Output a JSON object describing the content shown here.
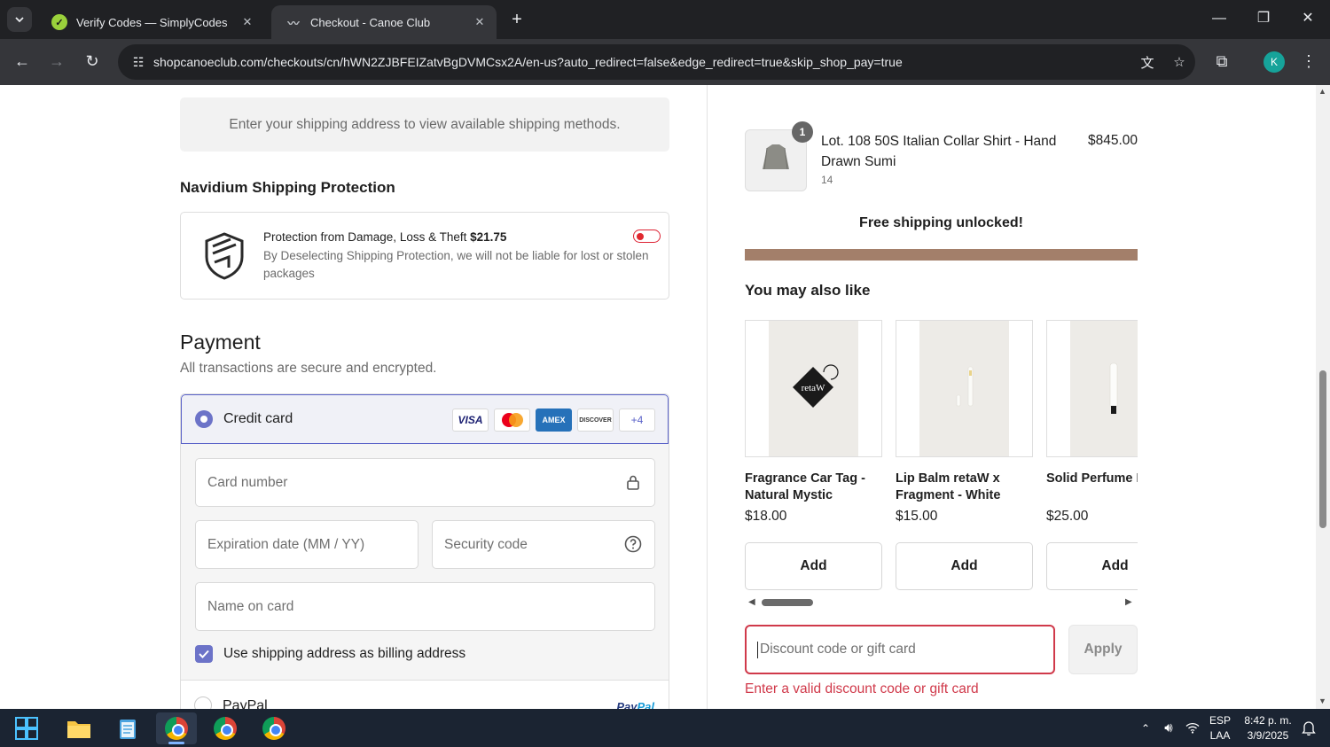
{
  "browser": {
    "tabs": [
      {
        "title": "Verify Codes — SimplyCodes",
        "active": false
      },
      {
        "title": "Checkout - Canoe Club",
        "active": true
      }
    ],
    "url": "shopcanoeclub.com/checkouts/cn/hWN2ZJBFEIZatvBgDVMCsx2A/en-us?auto_redirect=false&edge_redirect=true&skip_shop_pay=true",
    "profile_initial": "K"
  },
  "shipping": {
    "note": "Enter your shipping address to view available shipping methods."
  },
  "protection": {
    "heading": "Navidium Shipping Protection",
    "line1_prefix": "Protection from Damage, Loss & Theft",
    "price": "$21.75",
    "line2": "By Deselecting Shipping Protection, we will not be liable for lost or stolen packages",
    "toggle_on": false
  },
  "payment": {
    "heading": "Payment",
    "subheading": "All transactions are secure and encrypted.",
    "credit_card_label": "Credit card",
    "card_brands": [
      "VISA",
      "mastercard",
      "AMEX",
      "DISCOVER",
      "+4"
    ],
    "card_number_placeholder": "Card number",
    "expiry_placeholder": "Expiration date (MM / YY)",
    "security_placeholder": "Security code",
    "name_placeholder": "Name on card",
    "billing_label": "Use shipping address as billing address",
    "billing_checked": true,
    "paypal_label": "PayPal",
    "paypal_logo_a": "Pay",
    "paypal_logo_b": "Pal"
  },
  "order": {
    "quantity": "1",
    "product_name": "Lot. 108 50S Italian Collar Shirt - Hand Drawn Sumi",
    "variant": "14",
    "price": "$845.00",
    "free_shipping": "Free shipping unlocked!",
    "free_shipping_progress": 1.0,
    "also_like": "You may also like",
    "recommendations": [
      {
        "name": "Fragrance Car Tag - Natural Mystic",
        "price": "$18.00",
        "add": "Add",
        "logo_text": "retaW"
      },
      {
        "name": "Lip Balm retaW x Fragment - White",
        "price": "$15.00",
        "add": "Add"
      },
      {
        "name": "Solid Perfume Evelyn",
        "price": "$25.00",
        "add": "Add"
      }
    ],
    "discount_placeholder": "Discount code or gift card",
    "apply_label": "Apply",
    "discount_error": "Enter a valid discount code or gift card"
  },
  "taskbar": {
    "language": "ESP",
    "layout": "LAA",
    "time": "8:42 p. m.",
    "date": "3/9/2025"
  },
  "colors": {
    "accent": "#6c73c8",
    "error": "#d0394a",
    "progress_bar": "#a37f6a"
  }
}
